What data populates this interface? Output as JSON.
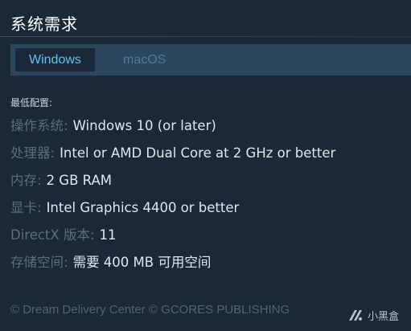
{
  "header": {
    "title": "系统需求"
  },
  "tabs": [
    {
      "label": "Windows",
      "active": true
    },
    {
      "label": "macOS",
      "active": false
    }
  ],
  "requirements": {
    "heading": "最低配置:",
    "separator": ":",
    "rows": [
      {
        "label": "操作系统",
        "value": "Windows 10 (or later)"
      },
      {
        "label": "处理器",
        "value": "Intel or AMD Dual Core at 2 GHz or better"
      },
      {
        "label": "内存",
        "value": "2 GB RAM"
      },
      {
        "label": "显卡",
        "value": "Intel Graphics 4400 or better"
      },
      {
        "label": "DirectX 版本",
        "value": "11"
      },
      {
        "label": "存储空间",
        "value": "需要 400 MB 可用空间"
      }
    ]
  },
  "footer": {
    "copyright": "© Dream Delivery Center © GCORES PUBLISHING"
  },
  "watermark": {
    "text": "小黑盒",
    "icon": "xiaoheihe-logo-icon"
  },
  "colors": {
    "background": "#1b2838",
    "tabbar": "#2a475e",
    "active_tab_text": "#66c0f4",
    "inactive_tab_text": "#4c7a9a",
    "label_text": "#56707f",
    "value_text": "#e2e6e9"
  }
}
